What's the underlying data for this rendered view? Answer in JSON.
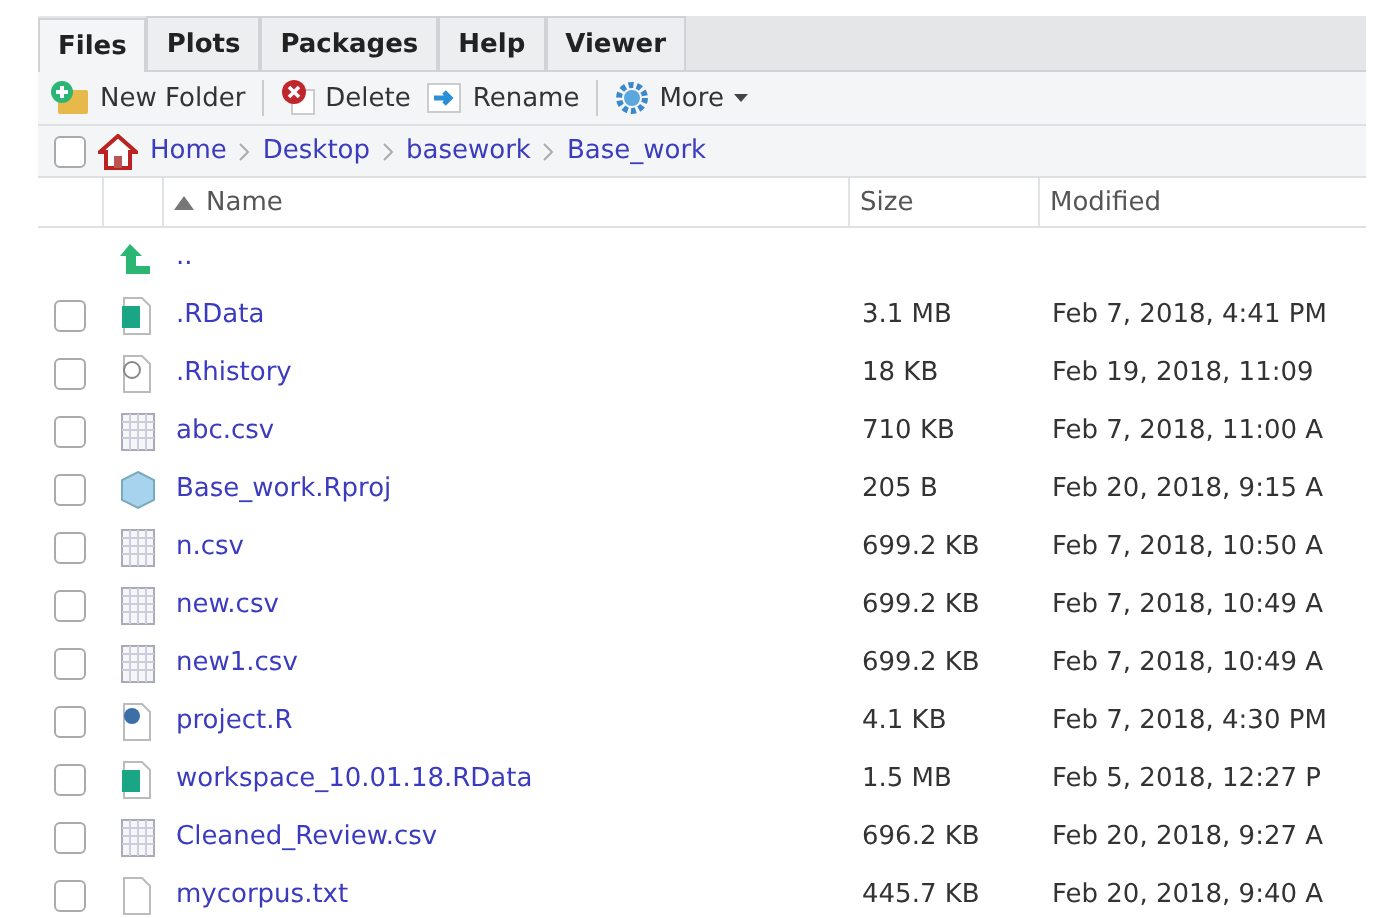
{
  "tabs": [
    {
      "label": "Files",
      "selected": true
    },
    {
      "label": "Plots",
      "selected": false
    },
    {
      "label": "Packages",
      "selected": false
    },
    {
      "label": "Help",
      "selected": false
    },
    {
      "label": "Viewer",
      "selected": false
    }
  ],
  "toolbar": [
    {
      "kind": "new-folder",
      "label": "New Folder"
    },
    {
      "kind": "delete",
      "label": "Delete"
    },
    {
      "kind": "rename",
      "label": "Rename"
    },
    {
      "kind": "more",
      "label": "More"
    }
  ],
  "select_all": {
    "checked": false
  },
  "breadcrumb": [
    "Home",
    "Desktop",
    "basework",
    "Base_work"
  ],
  "columns": [
    "Name",
    "Size",
    "Modified"
  ],
  "files": [
    {
      "kind": "parent",
      "name": ".."
    },
    {
      "kind": "rdata",
      "name": ".RData",
      "size": "3.1 MB",
      "modified": "Feb 7, 2018, 4:41 PM",
      "checked": false
    },
    {
      "kind": "rhistory",
      "name": ".Rhistory",
      "size": "18 KB",
      "modified": "Feb 19, 2018, 11:09",
      "checked": false
    },
    {
      "kind": "csv",
      "name": "abc.csv",
      "size": "710 KB",
      "modified": "Feb 7, 2018, 11:00 A",
      "checked": false
    },
    {
      "kind": "rproj",
      "name": "Base_work.Rproj",
      "size": "205 B",
      "modified": "Feb 20, 2018, 9:15 A",
      "checked": false
    },
    {
      "kind": "csv",
      "name": "n.csv",
      "size": "699.2 KB",
      "modified": "Feb 7, 2018, 10:50 A",
      "checked": false
    },
    {
      "kind": "csv",
      "name": "new.csv",
      "size": "699.2 KB",
      "modified": "Feb 7, 2018, 10:49 A",
      "checked": false
    },
    {
      "kind": "csv",
      "name": "new1.csv",
      "size": "699.2 KB",
      "modified": "Feb 7, 2018, 10:49 A",
      "checked": false
    },
    {
      "kind": "rscript",
      "name": "project.R",
      "size": "4.1 KB",
      "modified": "Feb 7, 2018, 4:30 PM",
      "checked": false
    },
    {
      "kind": "rdata",
      "name": "workspace_10.01.18.RData",
      "size": "1.5 MB",
      "modified": "Feb 5, 2018, 12:27 P",
      "checked": false
    },
    {
      "kind": "csv",
      "name": "Cleaned_Review.csv",
      "size": "696.2 KB",
      "modified": "Feb 20, 2018, 9:27 A",
      "checked": false
    },
    {
      "kind": "text",
      "name": "mycorpus.txt",
      "size": "445.7 KB",
      "modified": "Feb 20, 2018, 9:40 A",
      "checked": false
    }
  ]
}
